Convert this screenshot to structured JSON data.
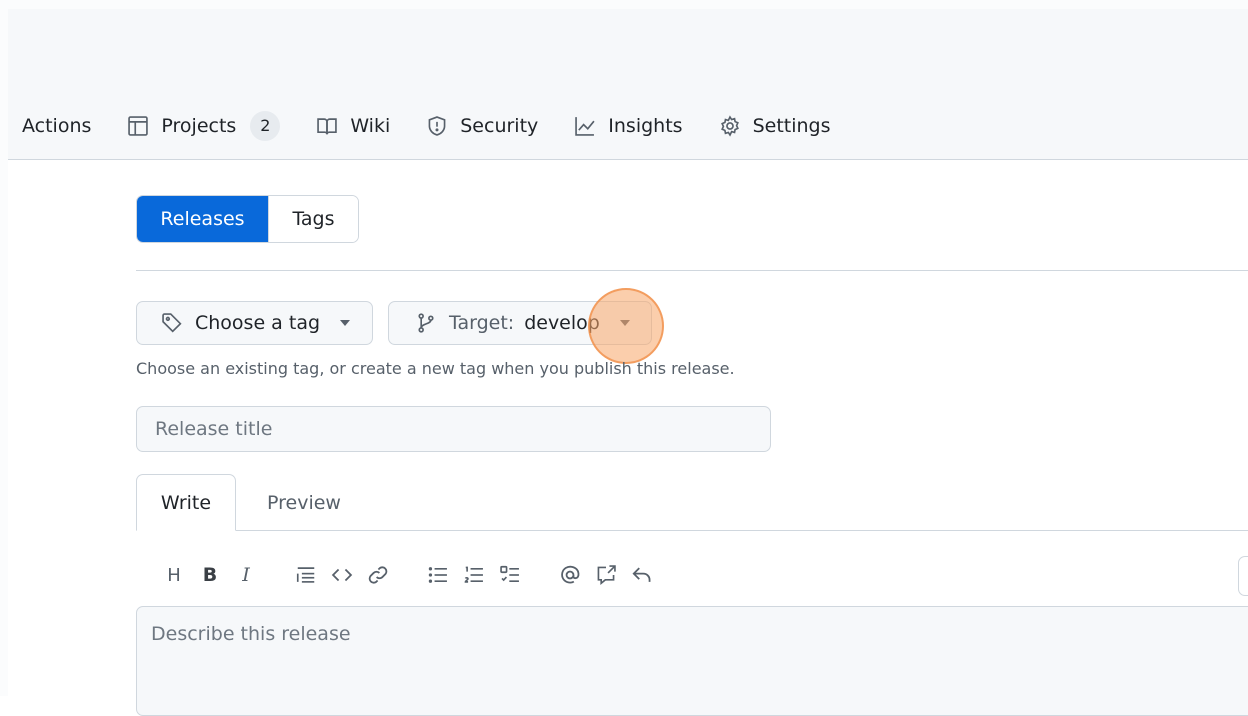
{
  "repo_nav": {
    "actions": "Actions",
    "projects": "Projects",
    "projects_count": "2",
    "wiki": "Wiki",
    "security": "Security",
    "insights": "Insights",
    "settings": "Settings"
  },
  "releases_nav": {
    "releases": "Releases",
    "tags": "Tags"
  },
  "tag_picker": {
    "label": "Choose a tag"
  },
  "target_picker": {
    "prefix": "Target:",
    "branch": "develop"
  },
  "hint": "Choose an existing tag, or create a new tag when you publish this release.",
  "release_title": {
    "placeholder": "Release title",
    "value": ""
  },
  "editor": {
    "tab_write": "Write",
    "tab_preview": "Preview",
    "toolbar_heading": "H",
    "toolbar_bold": "B",
    "toolbar_italic": "I",
    "description_placeholder": "Describe this release"
  },
  "icons": [
    "table-icon",
    "book-icon",
    "shield-icon",
    "graph-icon",
    "gear-icon",
    "tag-icon",
    "git-branch-icon",
    "quote-icon",
    "code-icon",
    "link-icon",
    "unordered-list-icon",
    "ordered-list-icon",
    "tasklist-icon",
    "mention-icon",
    "cross-reference-icon",
    "reply-icon"
  ],
  "colors": {
    "accent": "#0969da",
    "border": "#d0d7de",
    "muted": "#57606a",
    "cursor": "#f7a668"
  }
}
